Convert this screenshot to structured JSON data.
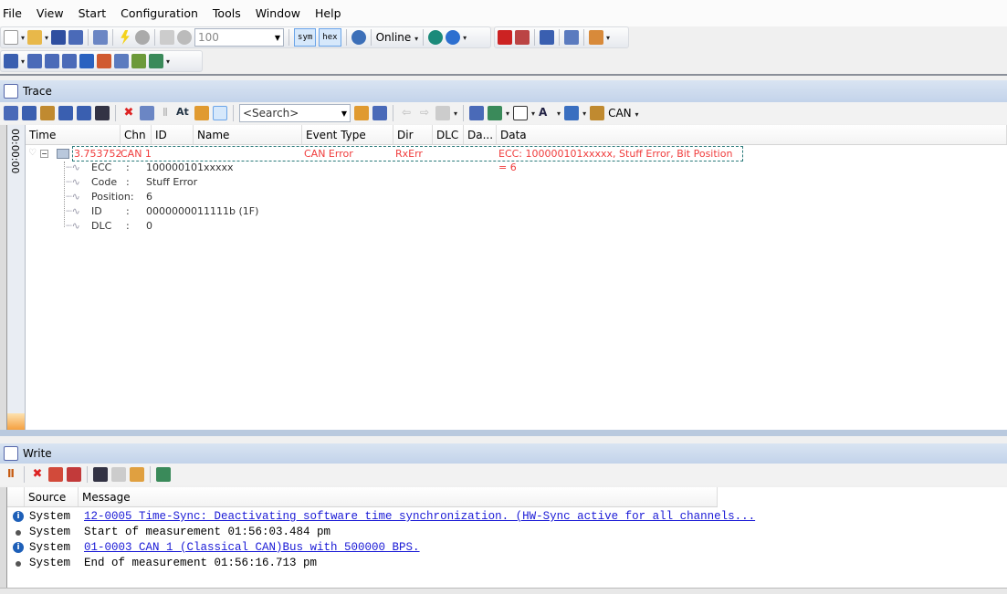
{
  "menu": [
    "File",
    "View",
    "Start",
    "Configuration",
    "Tools",
    "Window",
    "Help"
  ],
  "toolbar": {
    "zoom_value": "100",
    "sym": "sym",
    "hex": "hex",
    "online": "Online"
  },
  "trace": {
    "title": "Trace",
    "search_placeholder": "<Search>",
    "can_filter": "CAN",
    "timeline": "00:00:00",
    "columns": [
      "Time",
      "Chn",
      "ID",
      "Name",
      "Event Type",
      "Dir",
      "DLC",
      "Da...",
      "Data"
    ],
    "row": {
      "time": "3.753752",
      "chn": "CAN 1",
      "event_type": "CAN Error",
      "dir": "RxErr",
      "data": "ECC: 100000101xxxxx, Stuff Error, Bit Position = 6"
    },
    "details": [
      {
        "label": "ECC",
        "sep": ":",
        "value": "100000101xxxxx"
      },
      {
        "label": "Code",
        "sep": ":",
        "value": "Stuff Error"
      },
      {
        "label": "Position:",
        "sep": "",
        "value": "6"
      },
      {
        "label": "ID",
        "sep": ":",
        "value": "0000000011111b (1F)"
      },
      {
        "label": "DLC",
        "sep": ":",
        "value": "0"
      }
    ]
  },
  "write": {
    "title": "Write",
    "columns": [
      "Source",
      "Message"
    ],
    "rows": [
      {
        "icon": "info",
        "source": "System",
        "message": "12-0005 Time-Sync: Deactivating software time synchronization. (HW-Sync active for all channels...",
        "link": true
      },
      {
        "icon": "bullet",
        "source": "System",
        "message": "Start of measurement 01:56:03.484 pm",
        "link": false
      },
      {
        "icon": "info",
        "source": "System",
        "message": "01-0003 CAN 1 (Classical CAN)Bus with 500000 BPS.",
        "link": true
      },
      {
        "icon": "bullet",
        "source": "System",
        "message": "End of measurement 01:56:16.713 pm",
        "link": false
      }
    ]
  },
  "colors": {
    "error": "#f03c3c",
    "link": "#1a1ad6",
    "title_bar": "#c9d9ee"
  }
}
